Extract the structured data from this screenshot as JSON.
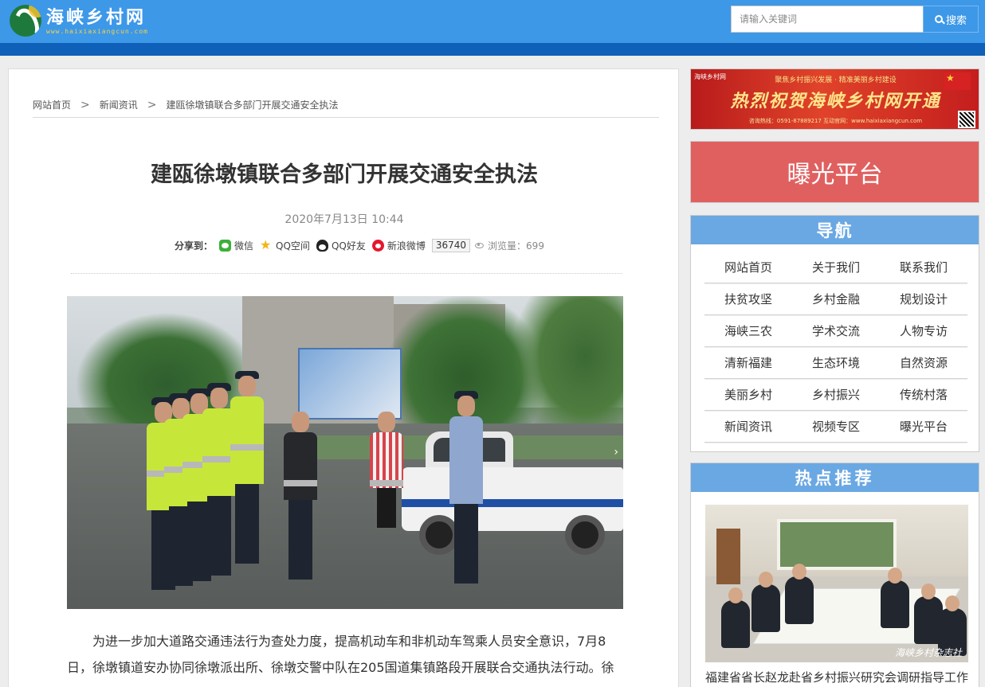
{
  "header": {
    "site_title": "海峡乡村网",
    "site_url": "www.haixiaxiangcun.com",
    "search_placeholder": "请输入关键词",
    "search_button": "搜索"
  },
  "breadcrumb": {
    "home": "网站首页",
    "section": "新闻资讯",
    "current": "建瓯徐墩镇联合多部门开展交通安全执法"
  },
  "article": {
    "title": "建瓯徐墩镇联合多部门开展交通安全执法",
    "date": "2020年7月13日 10:44",
    "share_label": "分享到：",
    "share_items": [
      "微信",
      "QQ空间",
      "QQ好友",
      "新浪微博"
    ],
    "share_count": "36740",
    "views": "浏览量：699",
    "body": "为进一步加大道路交通违法行为查处力度，提高机动车和非机动车驾乘人员安全意识，7月8日，徐墩镇道安办协同徐墩派出所、徐墩交警中队在205国道集镇路段开展联合交通执法行动。徐"
  },
  "sidebar": {
    "banner_top": "聚焦乡村振兴发展 · 精准美丽乡村建设",
    "banner_main": "热烈祝贺海峡乡村网开通",
    "banner_bottom": "咨询热线：0591-87889217    互动官网：www.haixiaxiangcun.com",
    "banner_logo": "海峡乡村网",
    "expose_label": "曝光平台",
    "nav_title": "导航",
    "nav_rows": [
      [
        "网站首页",
        "关于我们",
        "联系我们"
      ],
      [
        "扶贫攻坚",
        "乡村金融",
        "规划设计"
      ],
      [
        "海峡三农",
        "学术交流",
        "人物专访"
      ],
      [
        "清新福建",
        "生态环境",
        "自然资源"
      ],
      [
        "美丽乡村",
        "乡村振兴",
        "传统村落"
      ],
      [
        "新闻资讯",
        "视频专区",
        "曝光平台"
      ]
    ],
    "hot_title": "热点推荐",
    "hot_watermark": "海峡乡村杂志社",
    "hot_caption": "福建省省长赵龙赴省乡村振兴研究会调研指导工作"
  },
  "colors": {
    "header_blue": "#3d98e8",
    "header_strip": "#0e60b8",
    "expose_red": "#e06060",
    "box_head_blue": "#6aa8e3"
  },
  "icons": [
    "logo-icon",
    "search-icon",
    "wechat-icon",
    "qzone-icon",
    "qq-icon",
    "weibo-icon",
    "eye-icon",
    "chevron-right-icon"
  ]
}
